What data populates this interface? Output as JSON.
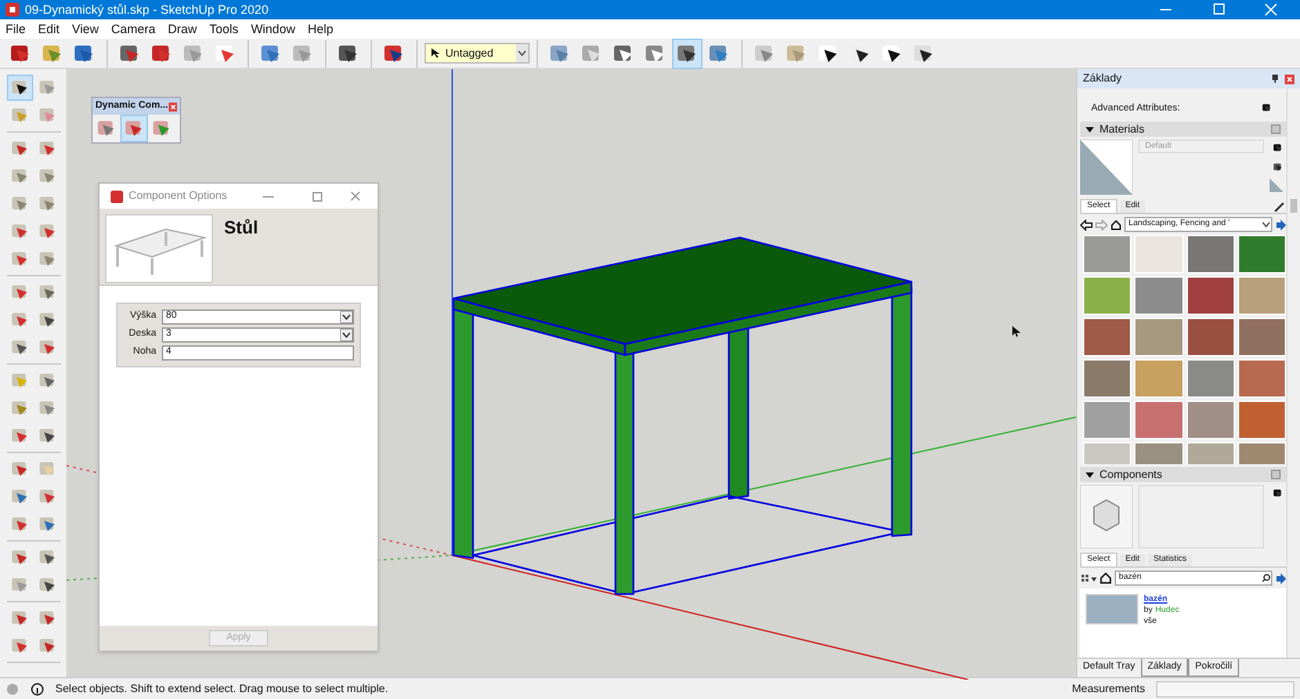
{
  "window": {
    "title": "09-Dynamický stůl.skp - SketchUp Pro 2020"
  },
  "menu": [
    "File",
    "Edit",
    "View",
    "Camera",
    "Draw",
    "Tools",
    "Window",
    "Help"
  ],
  "toolbar": {
    "tag": "Untagged",
    "styles": [
      {
        "selected": false
      },
      {
        "selected": false
      },
      {
        "selected": false
      },
      {
        "selected": false
      },
      {
        "selected": true
      },
      {
        "selected": false
      }
    ]
  },
  "tool_palette": [
    {
      "selected": true
    },
    {
      "selected": false
    },
    {
      "selected": false
    },
    {
      "selected": false
    },
    {
      "selected": false
    },
    {
      "selected": false
    },
    {
      "selected": false
    },
    {
      "selected": false
    },
    {
      "selected": false
    },
    {
      "selected": false
    },
    {
      "selected": false
    },
    {
      "selected": false
    },
    {
      "selected": false
    },
    {
      "selected": false
    },
    {
      "selected": false
    },
    {
      "selected": false
    },
    {
      "selected": false
    },
    {
      "selected": false
    },
    {
      "selected": false
    },
    {
      "selected": false
    },
    {
      "selected": false
    },
    {
      "selected": false
    },
    {
      "selected": false
    },
    {
      "selected": false
    },
    {
      "selected": false
    },
    {
      "selected": false
    },
    {
      "selected": false
    },
    {
      "selected": false
    },
    {
      "selected": false
    },
    {
      "selected": false
    },
    {
      "selected": false
    },
    {
      "selected": false
    },
    {
      "selected": false
    },
    {
      "selected": false
    },
    {
      "selected": false
    },
    {
      "selected": false
    },
    {
      "selected": false
    },
    {
      "selected": false
    },
    {
      "selected": false
    },
    {
      "selected": false
    }
  ],
  "dynamic_components": {
    "title": "Dynamic Com...",
    "buttons": [
      {
        "selected": false
      },
      {
        "selected": true
      },
      {
        "selected": false
      }
    ]
  },
  "component_options": {
    "title": "Component Options",
    "name": "Stůl",
    "attributes": [
      {
        "label": "Výška",
        "value": "80",
        "kind": "dropdown"
      },
      {
        "label": "Deska",
        "value": "3",
        "kind": "dropdown"
      },
      {
        "label": "Noha",
        "value": "4",
        "kind": "text"
      }
    ],
    "apply_button": {
      "label": "Apply",
      "disabled": true
    }
  },
  "tray": {
    "title": "Základy",
    "advanced_attributes": "Advanced Attributes:",
    "materials": {
      "title": "Materials",
      "current": "Default",
      "tabs": [
        {
          "label": "Select",
          "selected": true
        },
        {
          "label": "Edit",
          "selected": false
        }
      ],
      "collection": "Landscaping, Fencing and '"
    },
    "components": {
      "title": "Components",
      "tabs": [
        {
          "label": "Select",
          "selected": true
        },
        {
          "label": "Edit",
          "selected": false
        },
        {
          "label": "Statistics",
          "selected": false
        }
      ],
      "search": "bazén",
      "result": {
        "name": "bazén",
        "by": "by",
        "author": "Hudec",
        "note": "vše"
      }
    },
    "tabs": [
      {
        "label": "Default Tray",
        "selected": true
      },
      {
        "label": "Základy",
        "selected": false
      },
      {
        "label": "Pokročilí",
        "selected": false
      }
    ]
  },
  "status_bar": {
    "hint": "Select objects. Shift to extend select. Drag mouse to select multiple.",
    "measurements_label": "Measurements"
  }
}
